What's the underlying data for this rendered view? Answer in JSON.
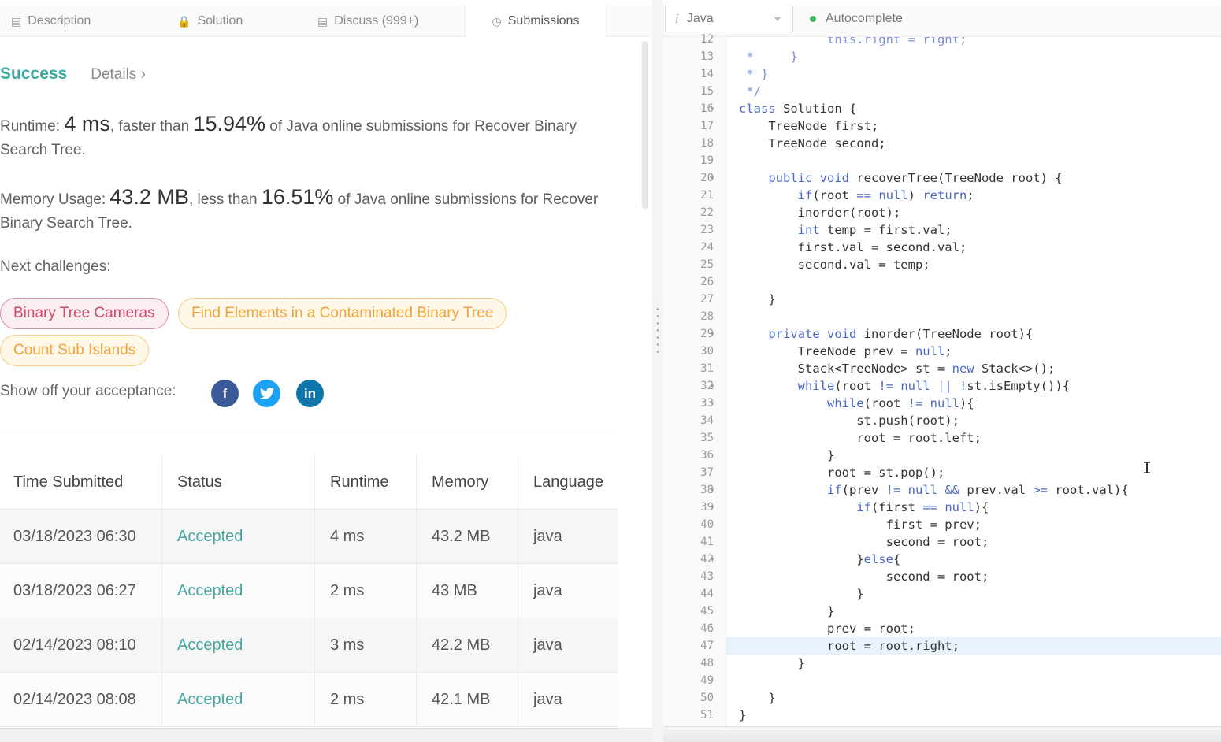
{
  "tabs": [
    {
      "label": "Description",
      "icon": "description-icon"
    },
    {
      "label": "Solution",
      "icon": "lock-icon"
    },
    {
      "label": "Discuss (999+)",
      "icon": "discuss-icon"
    },
    {
      "label": "Submissions",
      "icon": "clock-icon"
    }
  ],
  "result": {
    "status": "Success",
    "details": "Details"
  },
  "runtime": {
    "label": "Runtime: ",
    "value": "4 ms",
    "middle": ", faster than ",
    "percent": "15.94%",
    "suffix": " of Java online submissions for Recover Binary Search Tree."
  },
  "memory": {
    "label": "Memory Usage: ",
    "value": "43.2 MB",
    "middle": ", less than ",
    "percent": "16.51%",
    "suffix": " of Java online submissions for Recover Binary Search Tree."
  },
  "next_challenges": {
    "label": "Next challenges:",
    "items": [
      {
        "title": "Binary Tree Cameras",
        "difficulty": "hard"
      },
      {
        "title": "Find Elements in a Contaminated Binary Tree",
        "difficulty": "medium"
      },
      {
        "title": "Count Sub Islands",
        "difficulty": "medium"
      }
    ]
  },
  "share": {
    "label": "Show off your acceptance:",
    "icons": [
      "facebook-icon",
      "twitter-icon",
      "linkedin-icon"
    ]
  },
  "submissions": {
    "headers": [
      "Time Submitted",
      "Status",
      "Runtime",
      "Memory",
      "Language"
    ],
    "rows": [
      [
        "03/18/2023 06:30",
        "Accepted",
        "4 ms",
        "43.2 MB",
        "java"
      ],
      [
        "03/18/2023 06:27",
        "Accepted",
        "2 ms",
        "43 MB",
        "java"
      ],
      [
        "02/14/2023 08:10",
        "Accepted",
        "3 ms",
        "42.2 MB",
        "java"
      ],
      [
        "02/14/2023 08:08",
        "Accepted",
        "2 ms",
        "42.1 MB",
        "java"
      ]
    ]
  },
  "editor": {
    "language": "Java",
    "autocomplete": "Autocomplete",
    "lines": [
      {
        "n": "12",
        "text": "            this.right = right;",
        "fold": false
      },
      {
        "n": "13",
        "text": " *     }",
        "fold": false
      },
      {
        "n": "14",
        "text": " * }",
        "fold": false
      },
      {
        "n": "15",
        "text": " */",
        "fold": false
      },
      {
        "n": "16",
        "text": "class Solution {",
        "fold": true
      },
      {
        "n": "17",
        "text": "    TreeNode first;",
        "fold": false
      },
      {
        "n": "18",
        "text": "    TreeNode second;",
        "fold": false
      },
      {
        "n": "19",
        "text": "",
        "fold": false
      },
      {
        "n": "20",
        "text": "    public void recoverTree(TreeNode root) {",
        "fold": true
      },
      {
        "n": "21",
        "text": "        if(root == null) return;",
        "fold": false
      },
      {
        "n": "22",
        "text": "        inorder(root);",
        "fold": false
      },
      {
        "n": "23",
        "text": "        int temp = first.val;",
        "fold": false
      },
      {
        "n": "24",
        "text": "        first.val = second.val;",
        "fold": false
      },
      {
        "n": "25",
        "text": "        second.val = temp;",
        "fold": false
      },
      {
        "n": "26",
        "text": "",
        "fold": false
      },
      {
        "n": "27",
        "text": "    }",
        "fold": false
      },
      {
        "n": "28",
        "text": "",
        "fold": false
      },
      {
        "n": "29",
        "text": "    private void inorder(TreeNode root){",
        "fold": true
      },
      {
        "n": "30",
        "text": "        TreeNode prev = null;",
        "fold": false
      },
      {
        "n": "31",
        "text": "        Stack<TreeNode> st = new Stack<>();",
        "fold": false
      },
      {
        "n": "32",
        "text": "        while(root != null || !st.isEmpty()){",
        "fold": true
      },
      {
        "n": "33",
        "text": "            while(root != null){",
        "fold": true
      },
      {
        "n": "34",
        "text": "                st.push(root);",
        "fold": false
      },
      {
        "n": "35",
        "text": "                root = root.left;",
        "fold": false
      },
      {
        "n": "36",
        "text": "            }",
        "fold": false
      },
      {
        "n": "37",
        "text": "            root = st.pop();",
        "fold": false
      },
      {
        "n": "38",
        "text": "            if(prev != null && prev.val >= root.val){",
        "fold": true
      },
      {
        "n": "39",
        "text": "                if(first == null){",
        "fold": true
      },
      {
        "n": "40",
        "text": "                    first = prev;",
        "fold": false
      },
      {
        "n": "41",
        "text": "                    second = root;",
        "fold": false
      },
      {
        "n": "42",
        "text": "                }else{",
        "fold": true
      },
      {
        "n": "43",
        "text": "                    second = root;",
        "fold": false
      },
      {
        "n": "44",
        "text": "                }",
        "fold": false
      },
      {
        "n": "45",
        "text": "            }",
        "fold": false
      },
      {
        "n": "46",
        "text": "            prev = root;",
        "fold": false
      },
      {
        "n": "47",
        "text": "            root = root.right;",
        "fold": false,
        "highlight": true
      },
      {
        "n": "48",
        "text": "        }",
        "fold": false
      },
      {
        "n": "49",
        "text": "",
        "fold": false
      },
      {
        "n": "50",
        "text": "    }",
        "fold": false
      },
      {
        "n": "51",
        "text": "}",
        "fold": false
      }
    ]
  }
}
